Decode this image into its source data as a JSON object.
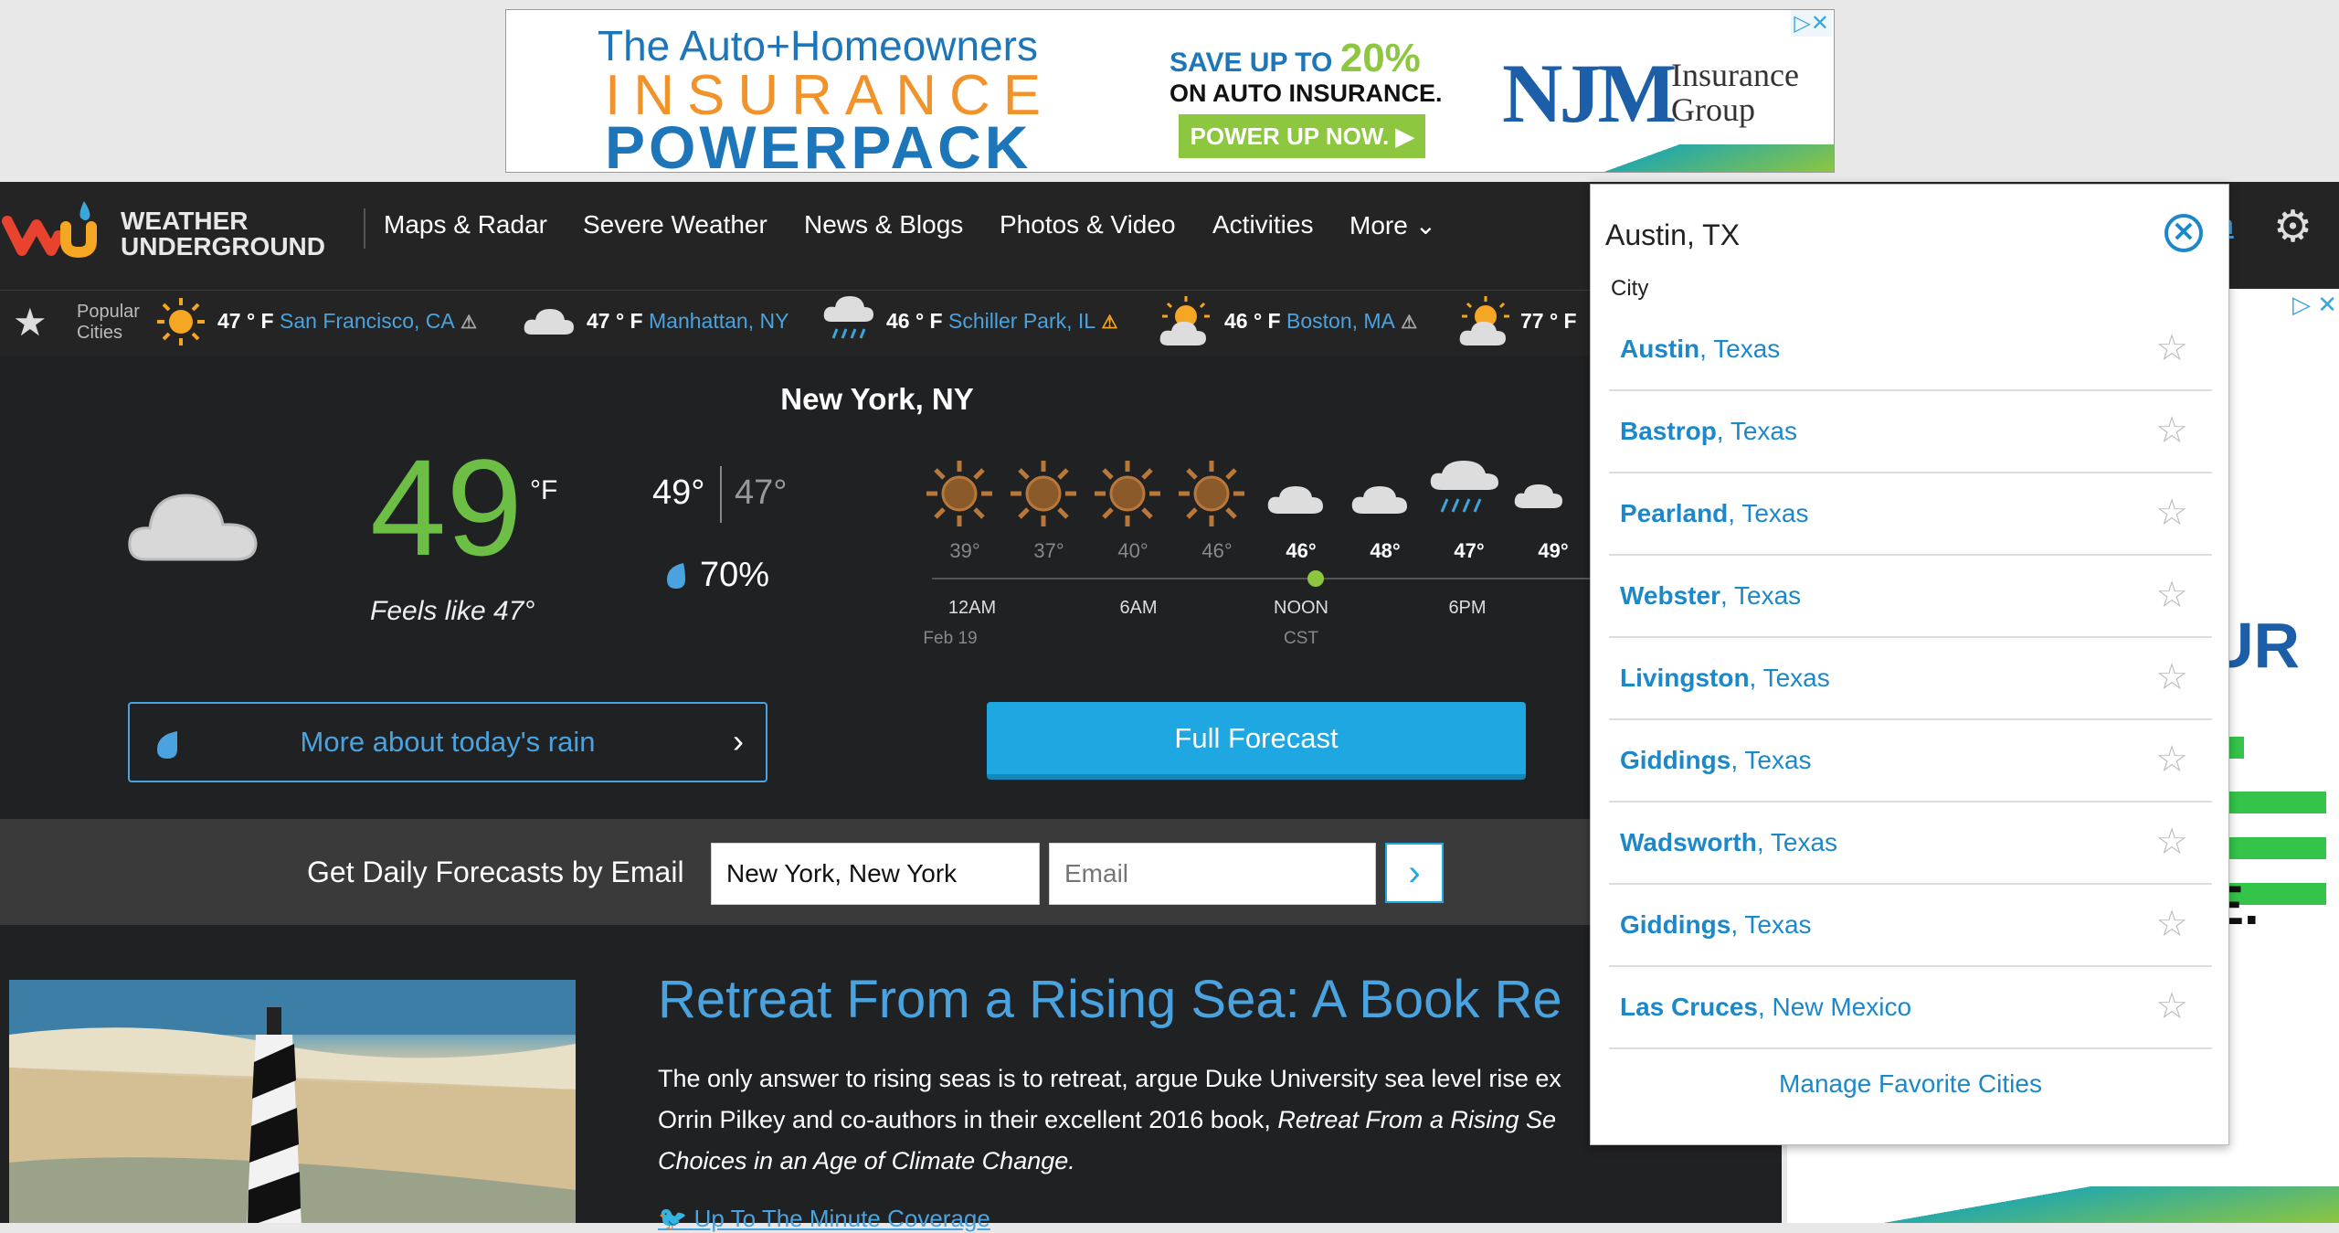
{
  "ad_top": {
    "line1": "The Auto+Homeowners",
    "line2": "INSURANCE",
    "line3": "POWERPACK",
    "save_prefix": "SAVE UP TO ",
    "save_pct": "20%",
    "save_line2": "ON AUTO INSURANCE.",
    "button": "POWER UP NOW.",
    "brand": "NJM",
    "brand_sub1": "Insurance",
    "brand_sub2": "Group"
  },
  "nav": {
    "logo_line1": "WEATHER",
    "logo_line2": "UNDERGROUND",
    "items": [
      "Maps & Radar",
      "Severe Weather",
      "News & Blogs",
      "Photos & Video",
      "Activities",
      "More"
    ],
    "hidden_link": "n"
  },
  "popular": {
    "label1": "Popular",
    "label2": "Cities",
    "cities": [
      {
        "temp": "47 ° F",
        "name": "San Francisco, CA"
      },
      {
        "temp": "47 ° F",
        "name": "Manhattan, NY"
      },
      {
        "temp": "46 ° F",
        "name": "Schiller Park, IL"
      },
      {
        "temp": "46 ° F",
        "name": "Boston, MA"
      },
      {
        "temp": "77 ° F",
        "name": ""
      }
    ]
  },
  "current": {
    "city": "New York, NY",
    "temp": "49",
    "unit": "°F",
    "feels_like": "Feels like 47°",
    "high": "49°",
    "low": "47°",
    "humidity": "70%",
    "rain_button": "More about today's rain",
    "forecast_button": "Full Forecast"
  },
  "hourly": {
    "temps": [
      "39°",
      "37°",
      "40°",
      "46°",
      "46°",
      "48°",
      "47°",
      "49°"
    ],
    "labels": [
      "12AM",
      "6AM",
      "NOON",
      "6PM"
    ],
    "sublabels": [
      "Feb 19",
      "CST"
    ]
  },
  "email": {
    "label": "Get Daily Forecasts by Email",
    "location_value": "New York, New York",
    "email_placeholder": "Email"
  },
  "article": {
    "title": "Retreat From a Rising Sea: A Book Re",
    "body_line1": "The only answer to rising seas is to retreat, argue Duke University sea level rise ex",
    "body_line2a": "Orrin Pilkey and co-authors in their excellent 2016 book, ",
    "body_line2b": "Retreat From a Rising Se",
    "body_line3": "Choices in an Age of Climate Change.",
    "link": "Up To The Minute Coverage"
  },
  "right_ad": {
    "text": "UR",
    "text2": "E."
  },
  "search": {
    "query": "Austin, TX",
    "category": "City",
    "results": [
      {
        "city": "Austin",
        "state": ", Texas"
      },
      {
        "city": "Bastrop",
        "state": ", Texas"
      },
      {
        "city": "Pearland",
        "state": ", Texas"
      },
      {
        "city": "Webster",
        "state": ", Texas"
      },
      {
        "city": "Livingston",
        "state": ", Texas"
      },
      {
        "city": "Giddings",
        "state": ", Texas"
      },
      {
        "city": "Wadsworth",
        "state": ", Texas"
      },
      {
        "city": "Giddings",
        "state": ", Texas"
      },
      {
        "city": "Las Cruces",
        "state": ", New Mexico"
      }
    ],
    "manage_link": "Manage Favorite Cities"
  },
  "colors": {
    "accent": "#4aa3df",
    "temp_green": "#6cbe45",
    "button_blue": "#1ea7e1",
    "dark_bg": "#202123"
  }
}
